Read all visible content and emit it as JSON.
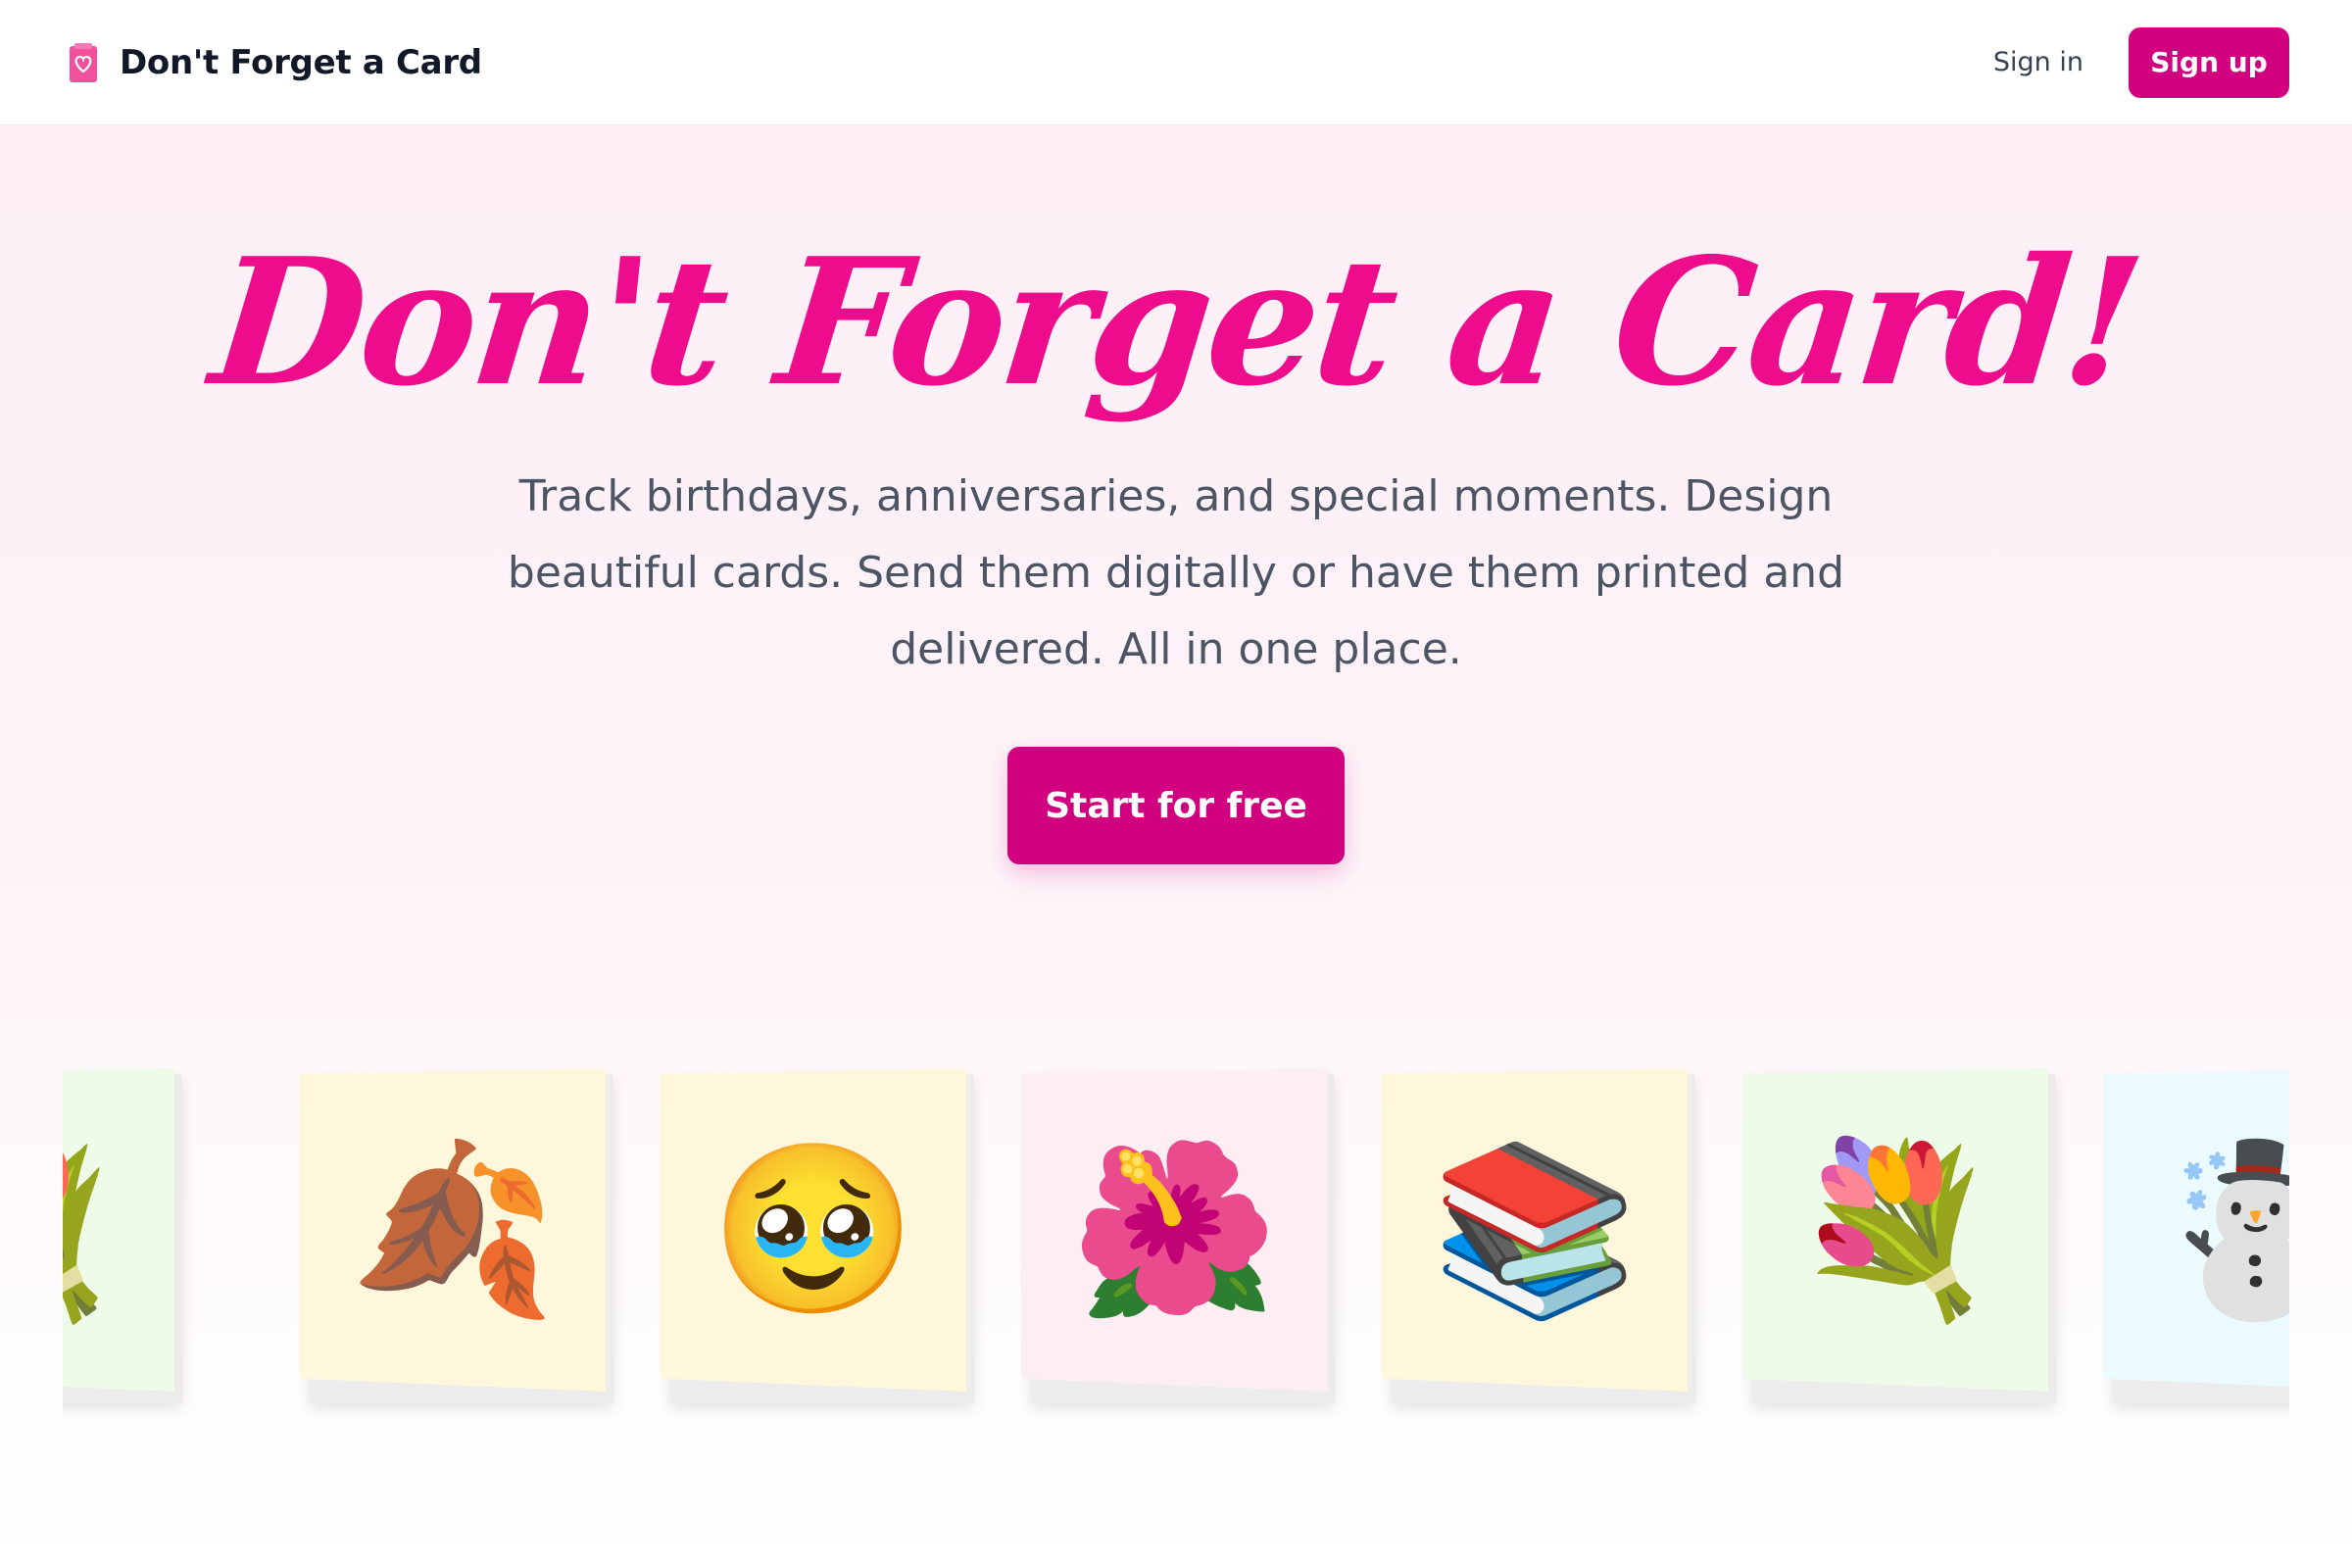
{
  "header": {
    "brand_name": "Don't Forget a Card",
    "brand_icon": "card-heart-icon",
    "signin_label": "Sign in",
    "signup_label": "Sign up"
  },
  "hero": {
    "headline": "Don't Forget a Card!",
    "subtext": "Track birthdays, anniversaries, and special moments. Design beautiful cards. Send them digitally or have them printed and delivered. All in one place.",
    "cta_label": "Start for free"
  },
  "colors": {
    "accent": "#d1007f",
    "headline": "#ec0c8c",
    "hero_bg": "#fdeef6"
  },
  "cards": [
    {
      "emoji": "💐",
      "icon": "bouquet-icon",
      "bg": "#eefbe9"
    },
    {
      "emoji": "🍂",
      "icon": "fallen-leaves-icon",
      "bg": "#fef7dc"
    },
    {
      "emoji": "🥹",
      "icon": "teary-face-icon",
      "bg": "#fef7dc"
    },
    {
      "emoji": "🌺",
      "icon": "hibiscus-icon",
      "bg": "#fdeef4"
    },
    {
      "emoji": "📚",
      "icon": "books-icon",
      "bg": "#fef7dc"
    },
    {
      "emoji": "💐",
      "icon": "bouquet-icon",
      "bg": "#eefbe9"
    },
    {
      "emoji": "☃️",
      "icon": "snowman-icon",
      "bg": "#ebfbfd"
    }
  ]
}
